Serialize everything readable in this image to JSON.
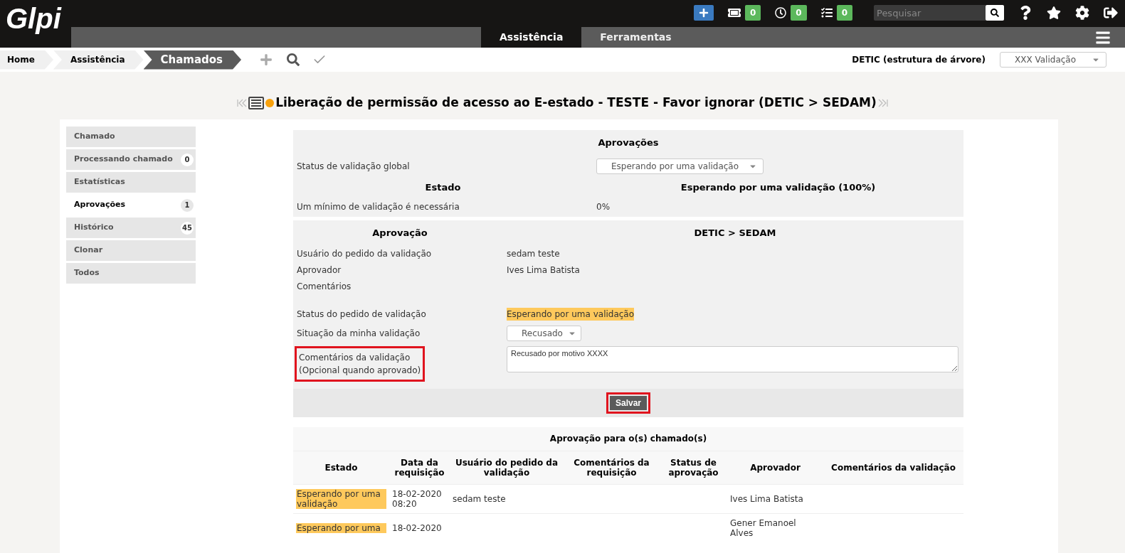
{
  "header": {
    "logo": "Glpi",
    "counters": [
      {
        "kind": "ticket",
        "count": "0"
      },
      {
        "kind": "clock",
        "count": "0"
      },
      {
        "kind": "tasks",
        "count": "0"
      }
    ],
    "search": {
      "placeholder": "Pesquisar"
    }
  },
  "nav_tabs": [
    {
      "label": "Assistência",
      "selected": true
    },
    {
      "label": "Ferramentas",
      "selected": false
    }
  ],
  "breadcrumbs": [
    {
      "label": "Home",
      "current": false
    },
    {
      "label": "Assistência",
      "current": false
    },
    {
      "label": "Chamados",
      "current": true
    }
  ],
  "entity": {
    "label": "DETIC (estrutura de árvore)",
    "profile": "XXX Validação"
  },
  "title": "Liberação de permissão de acesso ao E-estado - TESTE - Favor ignorar (DETIC > SEDAM)",
  "sidebar": {
    "items": [
      {
        "label": "Chamado",
        "selected": false
      },
      {
        "label": "Processando chamado",
        "badge": "0",
        "selected": false
      },
      {
        "label": "Estatísticas",
        "selected": false
      },
      {
        "label": "Aprovações",
        "badge": "1",
        "selected": true
      },
      {
        "label": "Histórico",
        "badge": "45",
        "selected": false
      },
      {
        "label": "Clonar",
        "selected": false
      },
      {
        "label": "Todos",
        "selected": false
      }
    ]
  },
  "approvals": {
    "heading": "Aprovações",
    "global_status_label": "Status de validação global",
    "global_status": "Esperando por uma validação",
    "state_heading": "Estado",
    "state_value": "Esperando por uma validação (100%)",
    "minimum_label": "Um mínimo de validação é necessária",
    "minimum_value": "0%"
  },
  "approval_form": {
    "heading": "Aprovação",
    "entity": "DETIC > SEDAM",
    "fields": [
      {
        "label": "Usuário do pedido da validação",
        "value": "sedam teste"
      },
      {
        "label": "Aprovador",
        "value": "Ives Lima Batista"
      },
      {
        "label": "Comentários"
      }
    ],
    "request_status_label": "Status do pedido de validação",
    "request_status": "Esperando por uma validação",
    "my_status_label": "Situação da minha validação",
    "my_status": "Recusado",
    "comments_label": "Comentários da validação",
    "comments_hint": "(Opcional quando aprovado)",
    "comments_highlighted": true,
    "comments_value": "Recusado por motivo XXXX",
    "save": {
      "label": "Salvar",
      "highlighted": true
    }
  },
  "table": {
    "title": "Aprovação para o(s) chamado(s)",
    "columns": [
      "Estado",
      "Data da requisição",
      "Usuário do pedido da validação",
      "Comentários da requisição",
      "Status de aprovação",
      "Aprovador",
      "Comentários da validação"
    ],
    "rows": [
      {
        "state": "Esperando por uma validação",
        "date": "18-02-2020 08:20",
        "requester": "sedam teste",
        "request_comments": "",
        "approval_status": "",
        "approver": "Ives Lima Batista",
        "validation_comments": ""
      },
      {
        "state": "Esperando por uma",
        "date": "18-02-2020",
        "requester": "",
        "request_comments": "",
        "approval_status": "",
        "approver": "Gener Emanoel Alves",
        "validation_comments": ""
      }
    ]
  }
}
